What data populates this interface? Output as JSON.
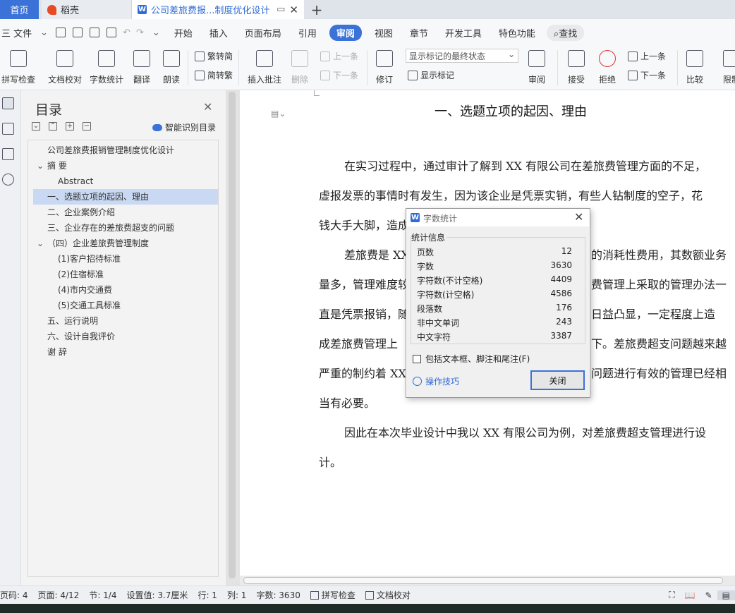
{
  "tabs": {
    "home": "首页",
    "daoke": "稻壳",
    "doc": "公司差旅费报...制度优化设计",
    "add": "+"
  },
  "menu": {
    "file": "三 文件",
    "items": [
      "开始",
      "插入",
      "页面布局",
      "引用",
      "审阅",
      "视图",
      "章节",
      "开发工具",
      "特色功能"
    ],
    "active": "审阅",
    "search": "查找"
  },
  "ribbon": {
    "spellcheck": "拼写检查",
    "doccheck": "文档校对",
    "wordcount": "字数统计",
    "translate": "翻译",
    "read": "朗读",
    "to_trad": "繁转简",
    "to_simp": "简转繁",
    "insert_comment": "插入批注",
    "delete": "删除",
    "prev": "上一条",
    "next": "下一条",
    "revise": "修订",
    "markup_state": "显示标记的最终状态",
    "show_markup": "显示标记",
    "review": "审阅",
    "accept": "接受",
    "reject": "拒绝",
    "prev2": "上一条",
    "next2": "下一条",
    "compare": "比较",
    "restrict": "限制"
  },
  "toc": {
    "title": "目录",
    "smart": "智能识别目录",
    "items": [
      {
        "text": "公司差旅费报销管理制度优化设计",
        "level": 0,
        "caret": ""
      },
      {
        "text": "摘  要",
        "level": 0,
        "caret": "v"
      },
      {
        "text": "Abstract",
        "level": 1,
        "caret": ""
      },
      {
        "text": "一、选题立项的起因、理由",
        "level": 0,
        "caret": "",
        "selected": true
      },
      {
        "text": "二、企业案例介绍",
        "level": 0,
        "caret": ""
      },
      {
        "text": "三、企业存在的差旅费超支的问题",
        "level": 0,
        "caret": ""
      },
      {
        "text": "（四）企业差旅费管理制度",
        "level": 0,
        "caret": "v"
      },
      {
        "text": "(1)客户招待标准",
        "level": 1,
        "caret": ""
      },
      {
        "text": "(2)住宿标准",
        "level": 1,
        "caret": ""
      },
      {
        "text": "(4)市内交通费",
        "level": 1,
        "caret": ""
      },
      {
        "text": "(5)交通工具标准",
        "level": 1,
        "caret": ""
      },
      {
        "text": "五、运行说明",
        "level": 0,
        "caret": ""
      },
      {
        "text": "六、设计自我评价",
        "level": 0,
        "caret": ""
      },
      {
        "text": "谢  辞",
        "level": 0,
        "caret": ""
      }
    ]
  },
  "document": {
    "heading": "一、选题立项的起因、理由",
    "lines": [
      {
        "text": "在实习过程中，通过审计了解到 XX 有限公司在差旅费管理方面的不足，",
        "indent": true
      },
      {
        "text": "虚报发票的事情时有发生，因为该企业是凭票实销，有些人钻制度的空子，花",
        "indent": false
      },
      {
        "text": "钱大手大脚，造成",
        "indent": false
      },
      {
        "text": "差旅费是 XX",
        "indent": true,
        "tail": "的消耗性费用，其数额业务"
      },
      {
        "text": "量多，管理难度较",
        "indent": false,
        "tail": "费管理上采取的管理办法一"
      },
      {
        "text": "直是凭票报销，随",
        "indent": false,
        "tail": "日益凸显，一定程度上造"
      },
      {
        "text": "成差旅费管理上",
        "indent": false,
        "tail": "下。差旅费超支问题越来越"
      },
      {
        "text": "严重的制约着 XX",
        "indent": false,
        "tail": "问题进行有效的管理已经相"
      },
      {
        "text": "当有必要。",
        "indent": false
      },
      {
        "text": "因此在本次毕业设计中我以 XX 有限公司为例，对差旅费超支管理进行设",
        "indent": true
      },
      {
        "text": "计。",
        "indent": false
      }
    ]
  },
  "dialog": {
    "title": "字数统计",
    "group": "统计信息",
    "stats": [
      {
        "label": "页数",
        "value": "12"
      },
      {
        "label": "字数",
        "value": "3630"
      },
      {
        "label": "字符数(不计空格)",
        "value": "4409"
      },
      {
        "label": "字符数(计空格)",
        "value": "4586"
      },
      {
        "label": "段落数",
        "value": "176"
      },
      {
        "label": "非中文单词",
        "value": "243"
      },
      {
        "label": "中文字符",
        "value": "3387"
      }
    ],
    "checkbox": "包括文本框、脚注和尾注(F)",
    "tips": "操作技巧",
    "close": "关闭"
  },
  "status": {
    "pagecode": "页码: 4",
    "page": "页面: 4/12",
    "section": "节: 1/4",
    "setting": "设置值: 3.7厘米",
    "row": "行: 1",
    "col": "列: 1",
    "words": "字数: 3630",
    "spell": "拼写检查",
    "doccheck": "文档校对"
  }
}
